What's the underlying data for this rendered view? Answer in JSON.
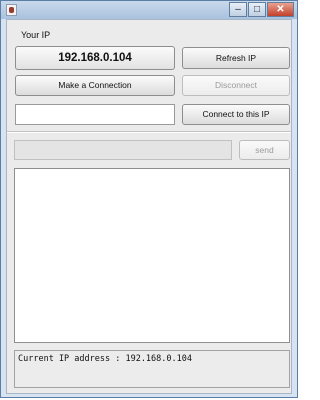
{
  "window": {
    "title": "",
    "controls": {
      "minimize": "–",
      "maximize": "□",
      "close": "✕"
    }
  },
  "ip_section": {
    "label": "Your IP",
    "ip_value": "192.168.0.104"
  },
  "buttons": {
    "refresh_ip": "Refresh IP",
    "make_connection": "Make a Connection",
    "disconnect": "Disconnect",
    "connect_to_ip": "Connect to this IP",
    "send": "send"
  },
  "inputs": {
    "ip_input_value": "",
    "message_input_value": ""
  },
  "status": {
    "text": "Current IP address : 192.168.0.104"
  }
}
